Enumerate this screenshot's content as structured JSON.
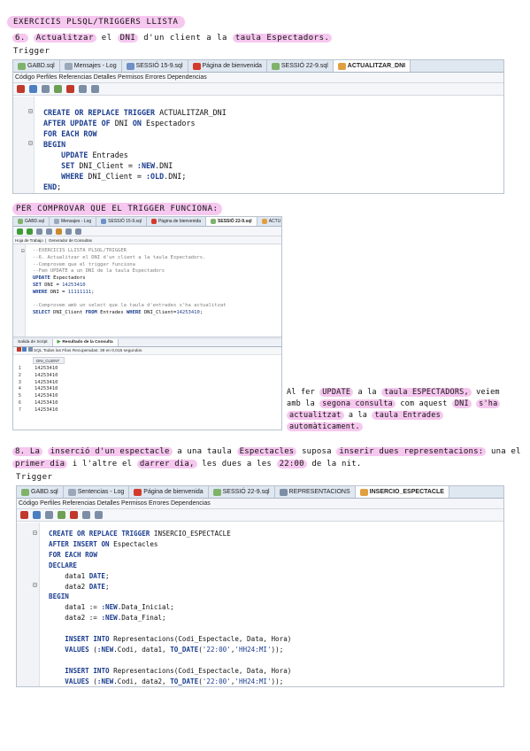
{
  "heading_main": "EXERCICIS PLSQL/TRIGGERS LLISTA",
  "q6": {
    "number": "6.",
    "text_1": "Actualitzar",
    "text_2": "el",
    "text_3": "DNI",
    "text_4": "d'un client a la",
    "text_5": "taula Espectadors."
  },
  "trigger_label_1": "Trigger",
  "ide1": {
    "tabs": [
      "GABD.sql",
      "Mensajes - Log",
      "SESSIÓ 15-9.sql",
      "Página de bienvenida",
      "SESSIÓ 22-9.sql",
      "ACTUALITZAR_DNI"
    ],
    "menu": "Código  Perfiles  Referencias  Detalles  Permisos  Errores  Dependencias",
    "code": [
      "CREATE OR REPLACE TRIGGER ACTUALITZAR_DNI",
      "AFTER UPDATE OF DNI ON Espectadors",
      "FOR EACH ROW",
      "BEGIN",
      "    UPDATE Entrades",
      "    SET DNI_Client = :NEW.DNI",
      "    WHERE DNI_Client = :OLD.DNI;",
      "END;"
    ]
  },
  "verify_heading": "PER COMPROVAR QUE EL TRIGGER FUNCIONA:",
  "ide2": {
    "tabs": [
      "GABD.sql",
      "Mensajes - Log",
      "SESSIÓ 15-9.sql",
      "Página de bienvenida",
      "SESSIÓ 22-9.sql",
      "ACTU"
    ],
    "subtabs": [
      "Hoja de Trabajo",
      "Generador de Consultas"
    ],
    "code": [
      "--EXERCICIS LLISTA PLSQL/TRIGGER",
      "--6. Actualitzar el DNI d'un client a la taula Espectadors.",
      "--Comprovem que el trigger funciona",
      "--Fem UPDATE a un DNI de la taula Espectadors",
      "UPDATE Espectadors",
      "SET DNI = 14253410",
      "WHERE DNI = 11111111;",
      "",
      "--Comprovem amb un select que la taula d'entrades s'ha actualitzat",
      "SELECT DNI_Client FROM Entrades WHERE DNI_Client=14253410;"
    ],
    "output_tabs": [
      "Salida de Script",
      "Resultado de la Consulta"
    ],
    "status": "SQL    Todas las Filas Recuperadas: 39 en 0,015 segundos",
    "column": "DNI_CLIENT",
    "rows": [
      {
        "n": "1",
        "v": "14253410"
      },
      {
        "n": "2",
        "v": "14253410"
      },
      {
        "n": "3",
        "v": "14253410"
      },
      {
        "n": "4",
        "v": "14253410"
      },
      {
        "n": "5",
        "v": "14253410"
      },
      {
        "n": "6",
        "v": "14253410"
      },
      {
        "n": "7",
        "v": "14253410"
      }
    ]
  },
  "note": {
    "t1": "Al fer",
    "t2": "UPDATE",
    "t3": "a la",
    "t4": "taula ESPECTADORS,",
    "t5": "veiem",
    "t6": "amb la",
    "t7": "segona consulta",
    "t8": "com aquest",
    "t9": "DNI",
    "t10": "s'ha",
    "t11": "actualitzat",
    "t12": "a la",
    "t13": "taula Entrades",
    "t14": "automàticament."
  },
  "q8": {
    "p1": "8. La",
    "p2": "inserció d'un espectacle",
    "p3": "a una taula",
    "p4": "Espectacles",
    "p5": "suposa",
    "p6": "inserir dues representacions:",
    "p7": "una el",
    "p8": "primer dia",
    "p9": "i l'altre el",
    "p10": "darrer dia,",
    "p11": "les dues a les",
    "p12": "22:00",
    "p13": "de la nit."
  },
  "trigger_label_2": "Trigger",
  "ide3": {
    "tabs": [
      "GABD.sql",
      "Sentencias - Log",
      "Página de bienvenida",
      "SESSIÓ 22-9.sql",
      "REPRESENTACIONS",
      "INSERCIO_ESPECTACLE"
    ],
    "menu": "Código  Perfiles  Referencias  Detalles  Permisos  Errores  Dependencias",
    "code": [
      "CREATE OR REPLACE TRIGGER INSERCIO_ESPECTACLE",
      "AFTER INSERT ON Espectacles",
      "FOR EACH ROW",
      "DECLARE",
      "    data1 DATE;",
      "    data2 DATE;",
      "BEGIN",
      "    data1 := :NEW.Data_Inicial;",
      "    data2 := :NEW.Data_Final;",
      "",
      "    INSERT INTO Representacions(Codi_Espectacle, Data, Hora)",
      "    VALUES (:NEW.Codi, data1, TO_DATE('22:00','HH24:MI'));",
      "",
      "    INSERT INTO Representacions(Codi_Espectacle, Data, Hora)",
      "    VALUES (:NEW.Codi, data2, TO_DATE('22:00','HH24:MI'));",
      "",
      "END;"
    ]
  },
  "colors": {
    "highlight": "#f6c7ef",
    "keyword": "#1b3d8f",
    "tab_bar": "#dfe7f1"
  }
}
